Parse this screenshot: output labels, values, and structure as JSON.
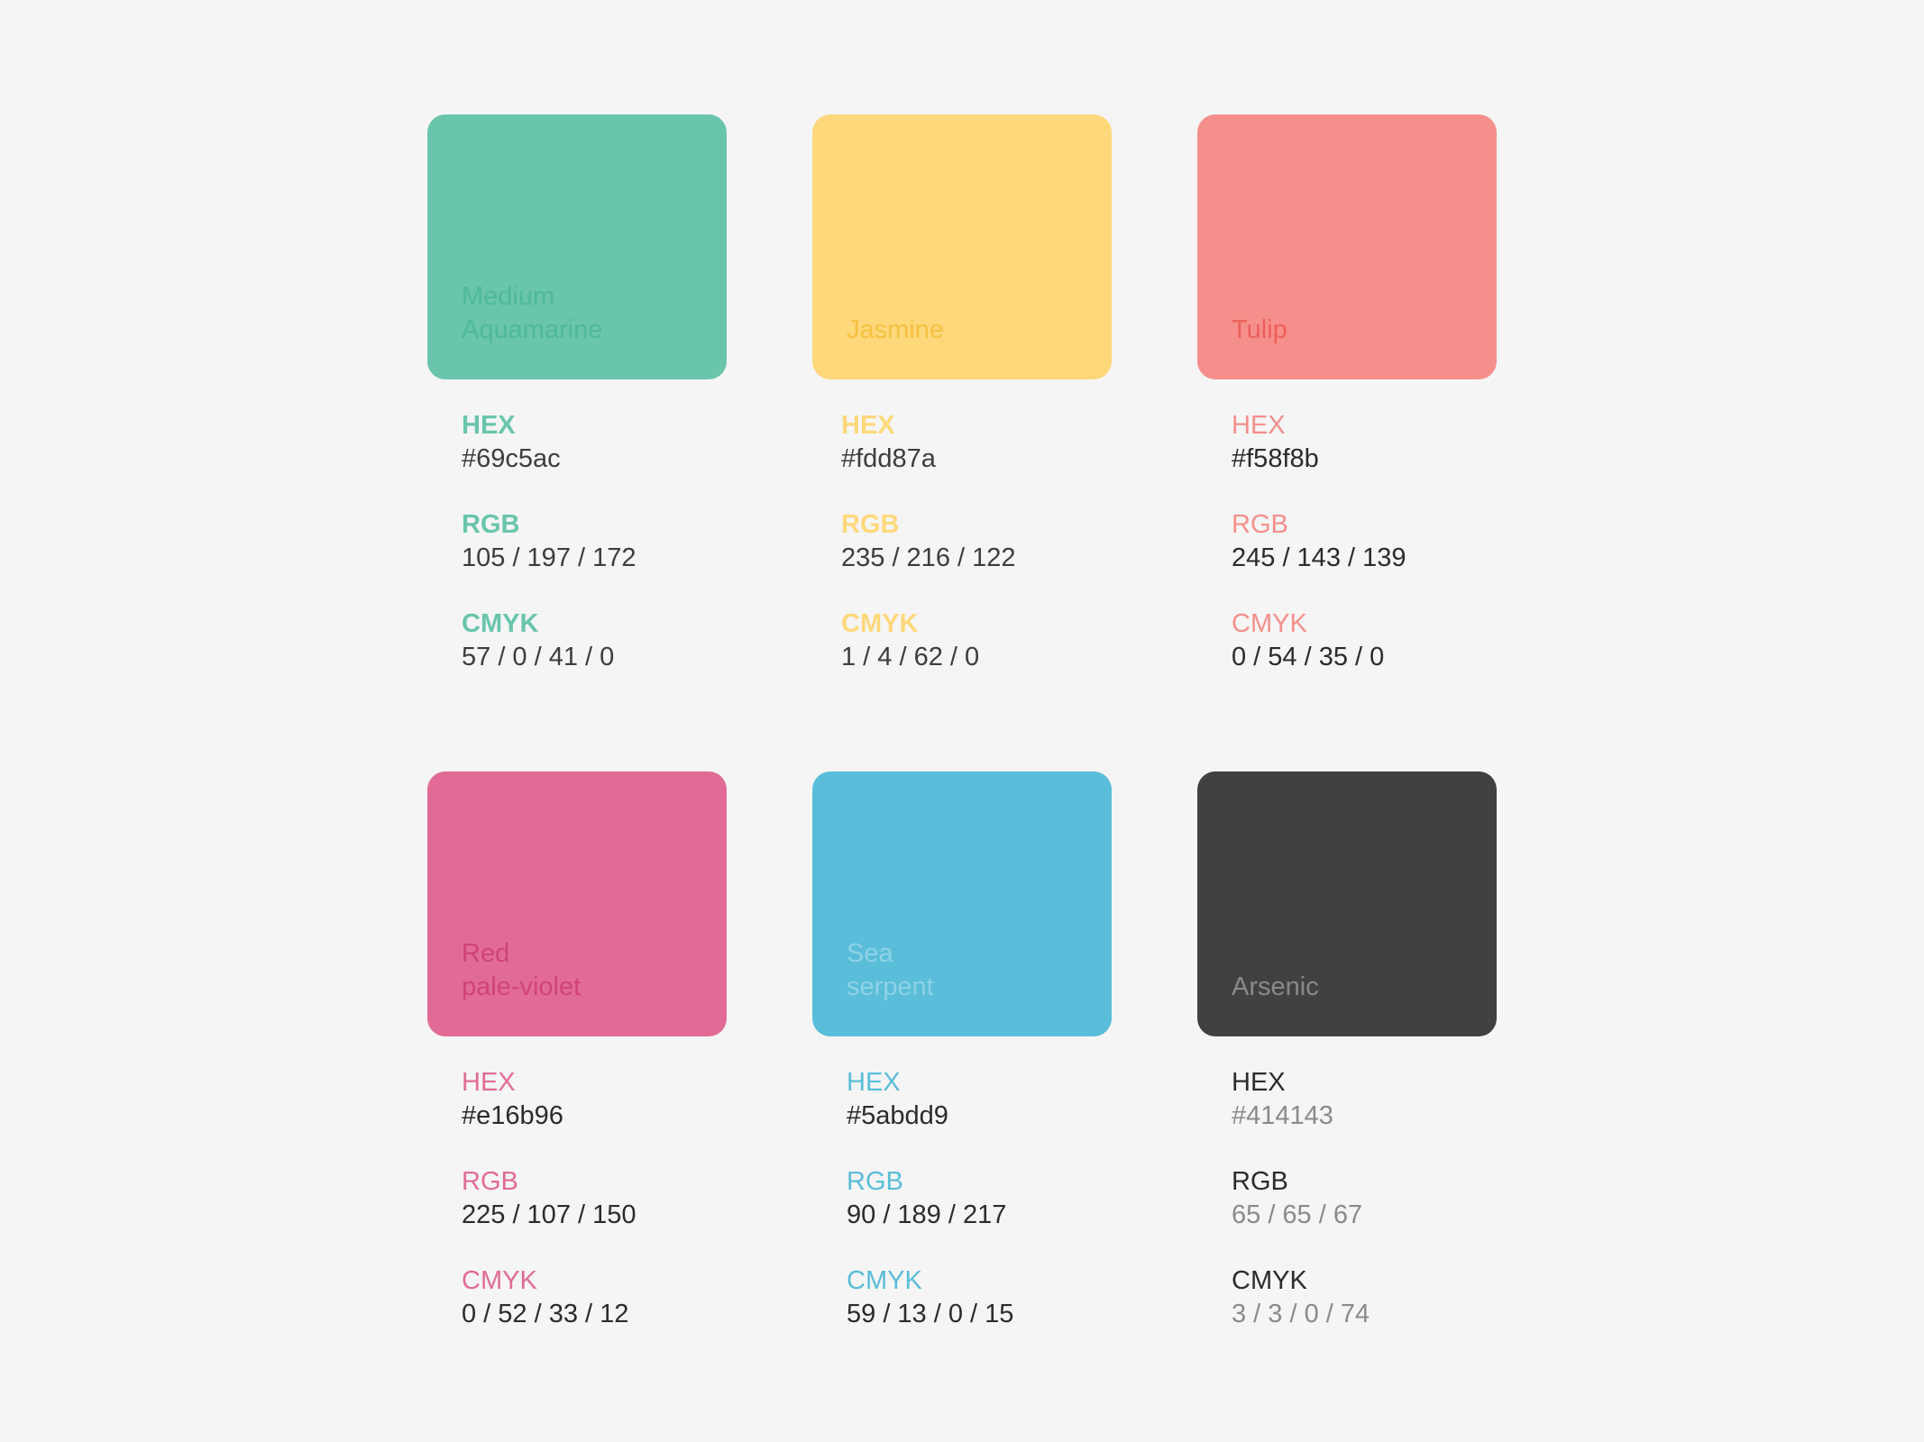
{
  "palette": [
    {
      "name": "Medium\nAquamarine",
      "swatch_color": "#69c5ac",
      "name_color": "#4fb998",
      "label_color": "#69c5ac",
      "value_color": "#3d3d40",
      "hex_label": "HEX",
      "hex": "#69c5ac",
      "rgb_label": "RGB",
      "rgb": "105 / 197 / 172",
      "cmyk_label": "CMYK",
      "cmyk": "57 / 0 / 41 / 0"
    },
    {
      "name": "Jasmine",
      "swatch_color": "#fed87a",
      "name_color": "#f6c141",
      "label_color": "#fed87a",
      "value_color": "#3d3d40",
      "hex_label": "HEX",
      "hex": "#fdd87a",
      "rgb_label": "RGB",
      "rgb": "235 / 216 / 122",
      "cmyk_label": "CMYK",
      "cmyk": "1 / 4 / 62 / 0"
    },
    {
      "name": "Tulip",
      "swatch_color": "#f58f8b",
      "name_color": "#ee5f5a",
      "label_color": "#f58f8b",
      "value_color": "#2b2b2e",
      "hex_label": "HEX",
      "hex": "#f58f8b",
      "rgb_label": "RGB",
      "rgb": "245 / 143 / 139",
      "cmyk_label": "CMYK",
      "cmyk": "0 / 54 / 35 / 0"
    },
    {
      "name": "Red\npale-violet",
      "swatch_color": "#e16b96",
      "name_color": "#cf4379",
      "label_color": "#e16b96",
      "value_color": "#2b2b2e",
      "hex_label": "HEX",
      "hex": "#e16b96",
      "rgb_label": "RGB",
      "rgb": "225 / 107 / 150",
      "cmyk_label": "CMYK",
      "cmyk": "0 / 52 / 33 / 12"
    },
    {
      "name": "Sea\nserpent",
      "swatch_color": "#5abdd9",
      "name_color": "#8ed2e6",
      "label_color": "#5abdd9",
      "value_color": "#2b2b2e",
      "hex_label": "HEX",
      "hex": "#5abdd9",
      "rgb_label": "RGB",
      "rgb": "90 / 189 / 217",
      "cmyk_label": "CMYK",
      "cmyk": "59 / 13 / 0 / 15"
    },
    {
      "name": "Arsenic",
      "swatch_color": "#414143",
      "name_color": "#8a8a8c",
      "label_color": "#2b2b2e",
      "value_color": "#8a8a8c",
      "hex_label": "HEX",
      "hex": "#414143",
      "rgb_label": "RGB",
      "rgb": "65 / 65 / 67",
      "cmyk_label": "CMYK",
      "cmyk": "3 / 3 / 0 / 74"
    }
  ]
}
